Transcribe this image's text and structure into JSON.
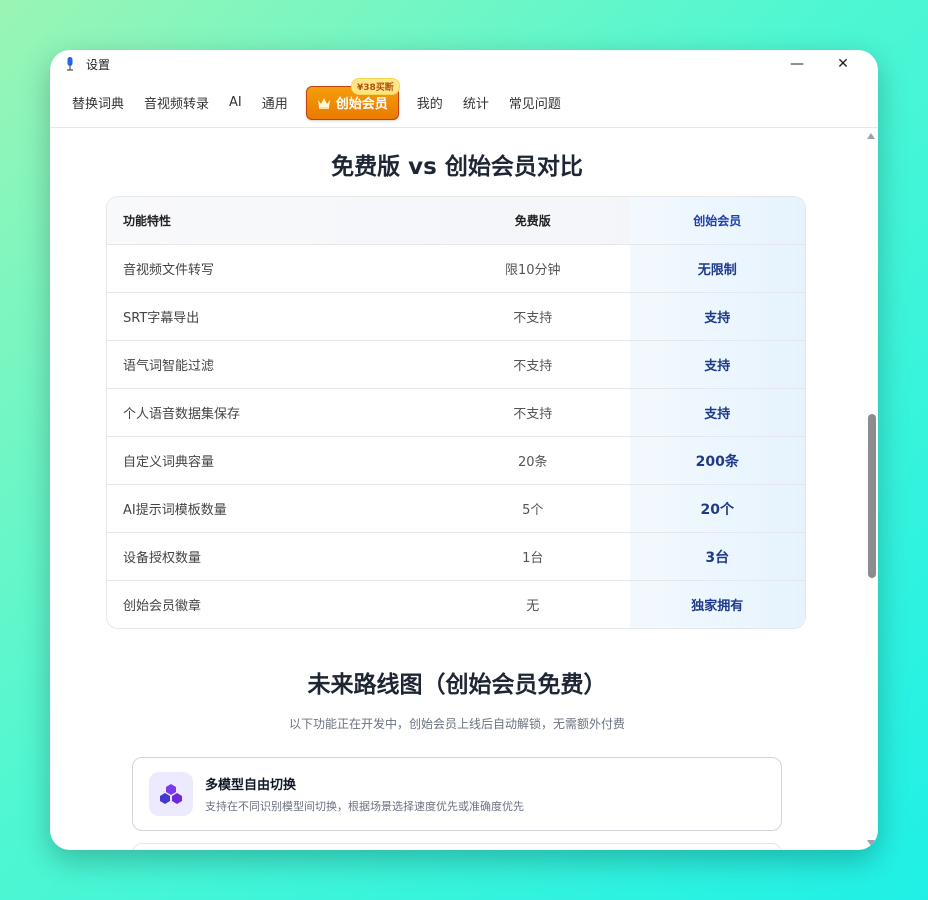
{
  "window": {
    "title": "设置",
    "minimize": "—",
    "close": "✕"
  },
  "nav": {
    "items": [
      "替换词典",
      "音视频转录",
      "AI",
      "通用"
    ],
    "vip_label": "创始会员",
    "vip_badge": "¥38买断",
    "items_after": [
      "我的",
      "统计",
      "常见问题"
    ]
  },
  "compare": {
    "title": "免费版 vs 创始会员对比",
    "headers": [
      "功能特性",
      "免费版",
      "创始会员"
    ],
    "rows": [
      [
        "音视频文件转写",
        "限10分钟",
        "无限制"
      ],
      [
        "SRT字幕导出",
        "不支持",
        "支持"
      ],
      [
        "语气词智能过滤",
        "不支持",
        "支持"
      ],
      [
        "个人语音数据集保存",
        "不支持",
        "支持"
      ],
      [
        "自定义词典容量",
        "20条",
        "200条"
      ],
      [
        "AI提示词模板数量",
        "5个",
        "20个"
      ],
      [
        "设备授权数量",
        "1台",
        "3台"
      ],
      [
        "创始会员徽章",
        "无",
        "独家拥有"
      ]
    ]
  },
  "roadmap": {
    "title": "未来路线图（创始会员免费）",
    "subtitle": "以下功能正在开发中，创始会员上线后自动解锁，无需额外付费",
    "cards": [
      {
        "icon": "cubes-icon",
        "title": "多模型自由切换",
        "desc": "支持在不同识别模型间切换，根据场景选择速度优先或准确度优先"
      }
    ]
  },
  "colors": {
    "accent": "#ea7a00",
    "member": "#1e3a8a",
    "icon_bg": "#ede9fe",
    "icon": "#6d28d9"
  }
}
